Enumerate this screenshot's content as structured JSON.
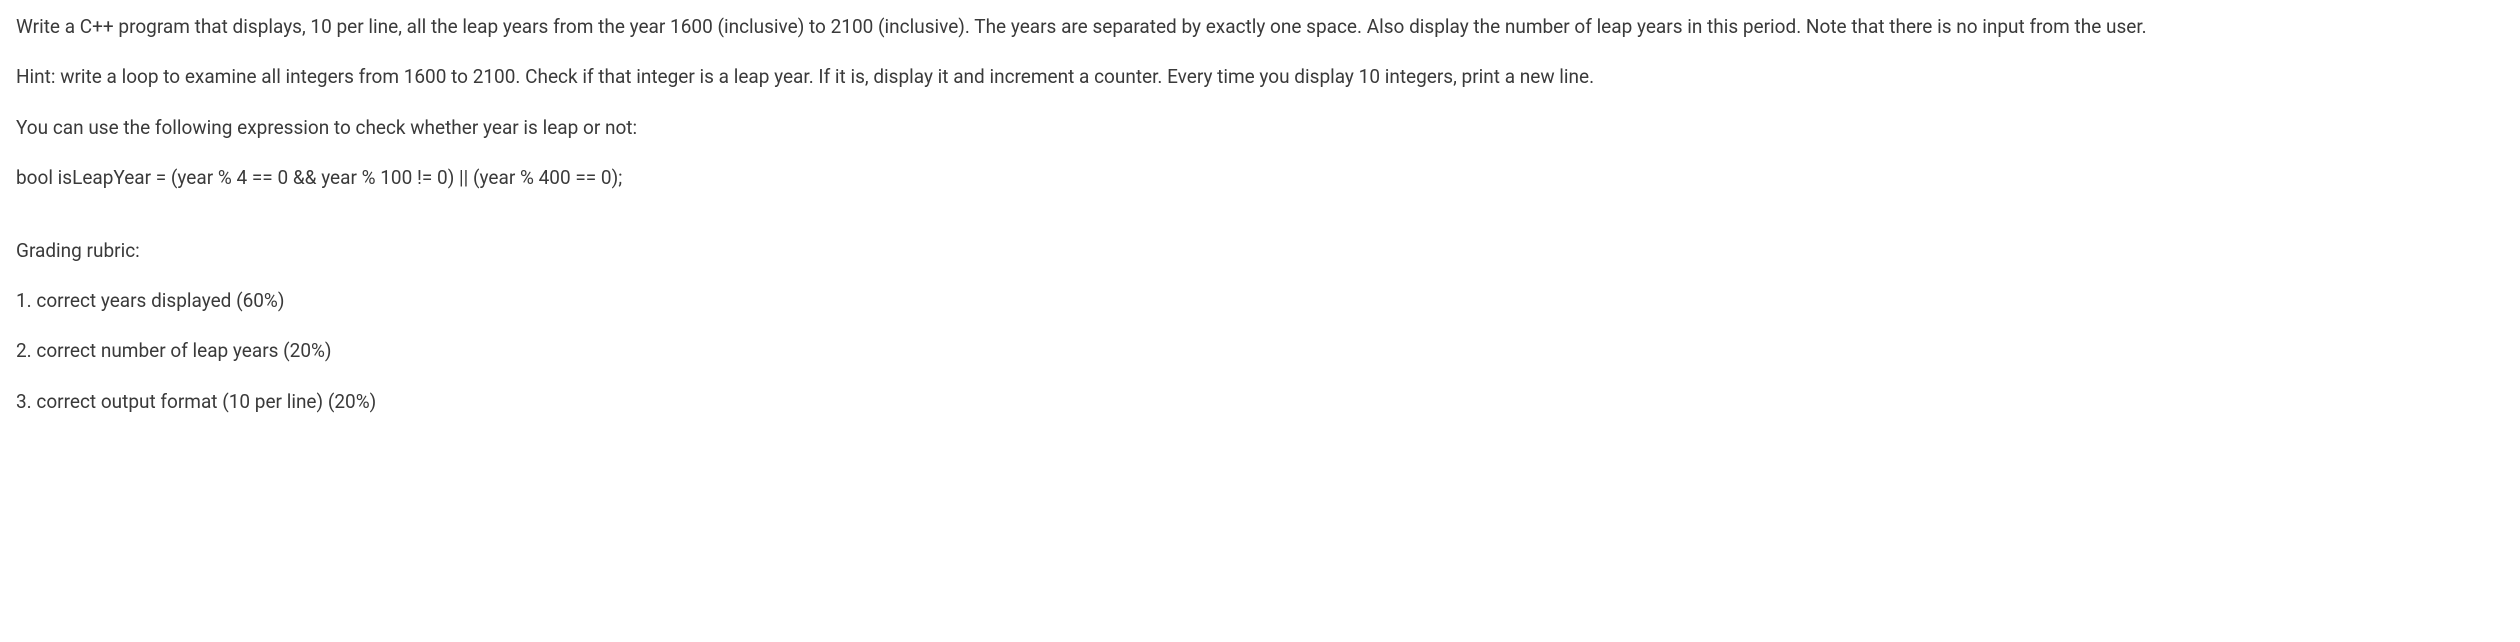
{
  "paragraphs": {
    "p1": "Write a C++ program that displays, 10 per line, all the leap years from the year 1600 (inclusive) to 2100 (inclusive). The years are separated by exactly one space. Also display the number of leap years in this period. Note that there is no input from the user.",
    "p2": "Hint: write a loop to examine all integers from 1600 to 2100. Check if that integer is a leap year. If it is, display it and increment a counter. Every time you display 10 integers, print a new line.",
    "p3": "You can use the following expression to check whether year is leap or not:",
    "p4": "bool isLeapYear = (year % 4 == 0 && year % 100 != 0) || (year % 400 == 0);",
    "p5": "Grading rubric:",
    "p6": "1. correct years displayed (60%)",
    "p7": "2. correct number of leap years (20%)",
    "p8": "3. correct output format (10 per line) (20%)"
  }
}
